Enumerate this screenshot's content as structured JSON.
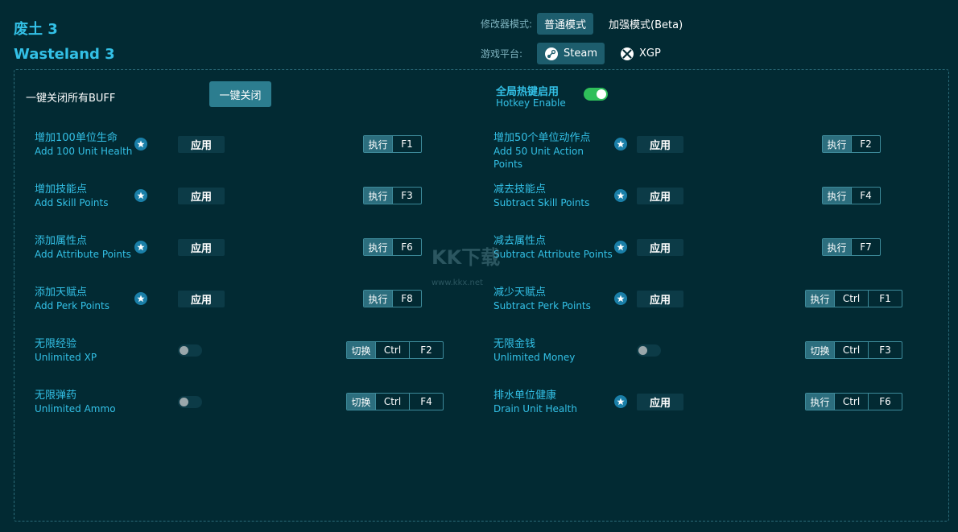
{
  "title": {
    "cn": "废土 3",
    "en": "Wasteland 3"
  },
  "mode": {
    "label": "修改器模式:",
    "options": [
      {
        "label": "普通模式",
        "active": true
      },
      {
        "label": "加强模式(Beta)",
        "active": false
      }
    ]
  },
  "platform": {
    "label": "游戏平台:",
    "options": [
      {
        "label": "Steam",
        "icon": "steam-icon",
        "active": true
      },
      {
        "label": "XGP",
        "icon": "xbox-icon",
        "active": false
      }
    ]
  },
  "all_buff": {
    "label": "一键关闭所有BUFF",
    "button": "一键关闭"
  },
  "hotkey": {
    "cn": "全局热键启用",
    "en": "Hotkey Enable",
    "enabled": true
  },
  "apply_label": "应用",
  "items": [
    {
      "cn": "增加100单位生命",
      "en": "Add 100 Unit Health",
      "star": true,
      "control": "apply",
      "action": "执行",
      "keys": [
        "F1"
      ]
    },
    {
      "cn": "增加50个单位动作点",
      "en": "Add 50 Unit Action",
      "en2": "Points",
      "star": true,
      "control": "apply",
      "action": "执行",
      "keys": [
        "F2"
      ]
    },
    {
      "cn": "增加技能点",
      "en": "Add Skill Points",
      "star": true,
      "control": "apply",
      "action": "执行",
      "keys": [
        "F3"
      ]
    },
    {
      "cn": "减去技能点",
      "en": "Subtract Skill Points",
      "star": true,
      "control": "apply",
      "action": "执行",
      "keys": [
        "F4"
      ]
    },
    {
      "cn": "添加属性点",
      "en": "Add Attribute Points",
      "star": true,
      "control": "apply",
      "action": "执行",
      "keys": [
        "F6"
      ]
    },
    {
      "cn": "减去属性点",
      "en": "Subtract Attribute Points",
      "star": true,
      "control": "apply",
      "action": "执行",
      "keys": [
        "F7"
      ]
    },
    {
      "cn": "添加天赋点",
      "en": "Add Perk Points",
      "star": true,
      "control": "apply",
      "action": "执行",
      "keys": [
        "F8"
      ]
    },
    {
      "cn": "减少天赋点",
      "en": "Subtract Perk Points",
      "star": true,
      "control": "apply",
      "action": "执行",
      "keys": [
        "Ctrl",
        "F1"
      ]
    },
    {
      "cn": "无限经验",
      "en": "Unlimited XP",
      "star": false,
      "control": "toggle",
      "action": "切换",
      "keys": [
        "Ctrl",
        "F2"
      ]
    },
    {
      "cn": "无限金钱",
      "en": "Unlimited Money",
      "star": false,
      "control": "toggle",
      "action": "切换",
      "keys": [
        "Ctrl",
        "F3"
      ]
    },
    {
      "cn": "无限弹药",
      "en": "Unlimited Ammo",
      "star": false,
      "control": "toggle",
      "action": "切换",
      "keys": [
        "Ctrl",
        "F4"
      ]
    },
    {
      "cn": "排水单位健康",
      "en": "Drain Unit Health",
      "star": true,
      "control": "apply",
      "action": "执行",
      "keys": [
        "Ctrl",
        "F6"
      ]
    }
  ],
  "watermark": {
    "text": "KK下载",
    "url": "www.kkx.net"
  },
  "colors": {
    "background": "#022a33",
    "accent": "#33c0e6",
    "toggle_on": "#2fbf5a"
  }
}
